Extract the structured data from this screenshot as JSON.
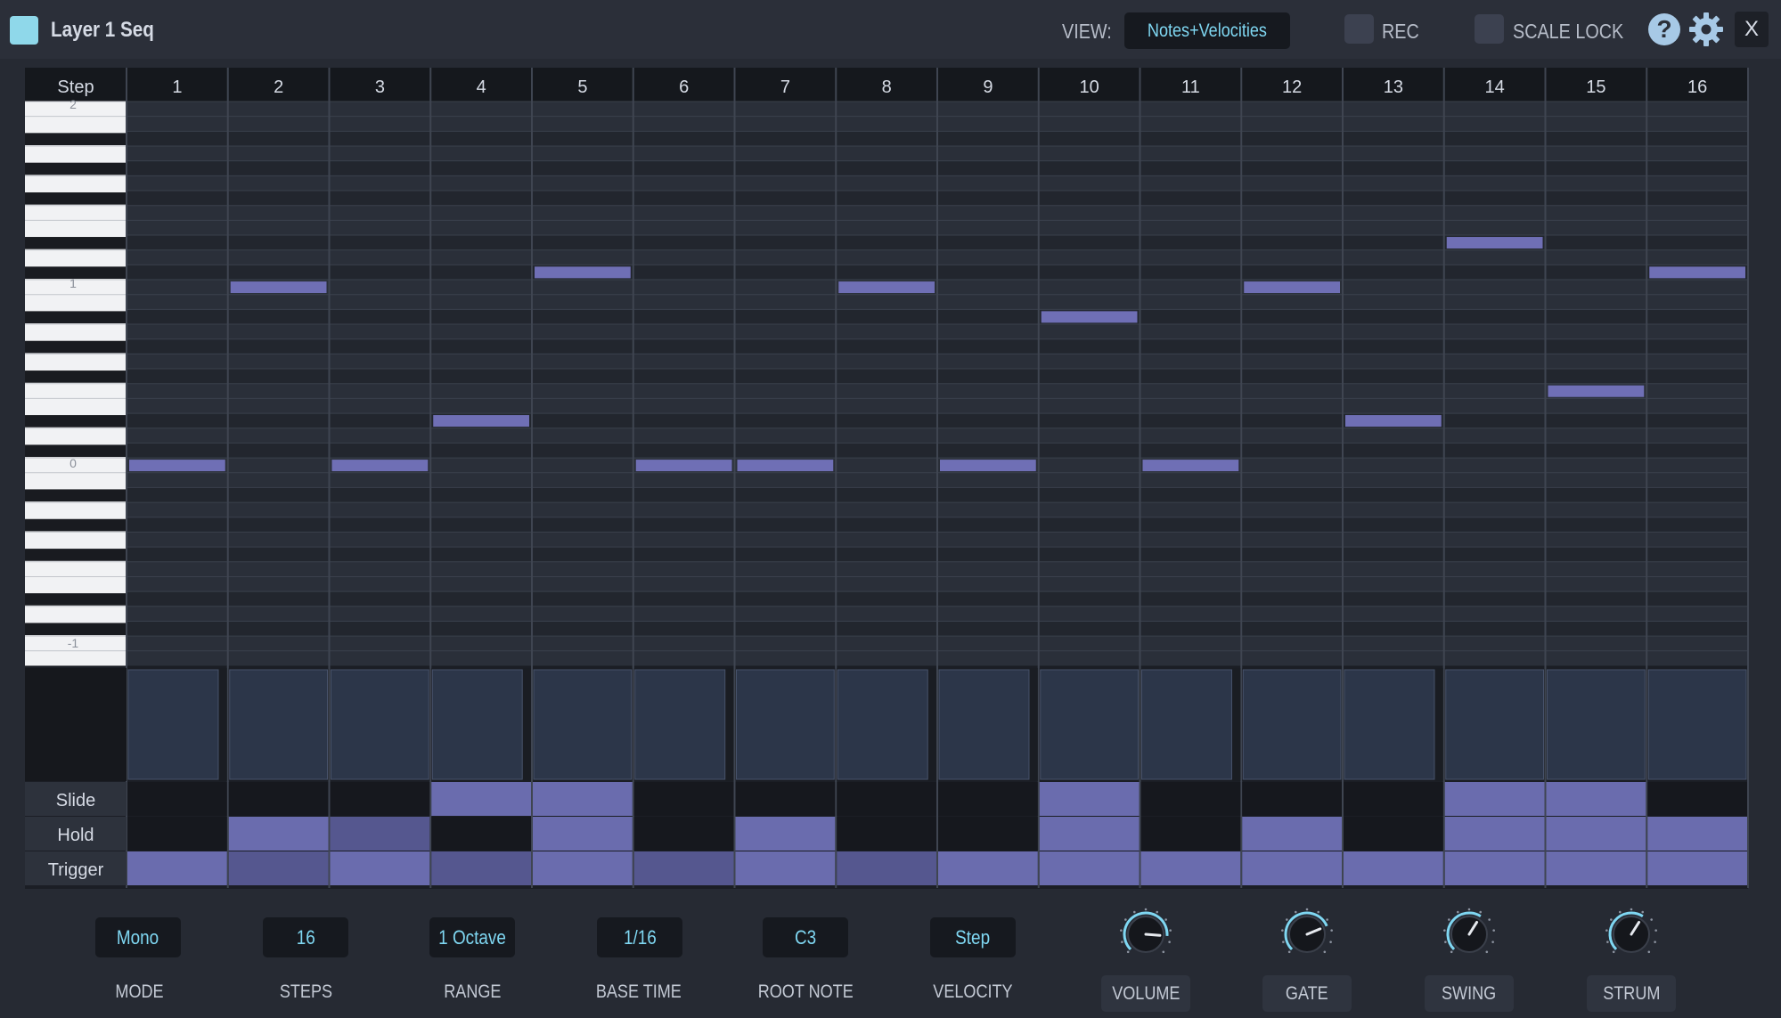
{
  "window": {
    "title": "Layer 1 Seq",
    "view_label": "VIEW:",
    "view_value": "Notes+Velocities",
    "rec_label": "REC",
    "scale_lock_label": "SCALE LOCK",
    "help_glyph": "?",
    "close_label": "X"
  },
  "sequencer": {
    "step_header": "Step",
    "steps": [
      "1",
      "2",
      "3",
      "4",
      "5",
      "6",
      "7",
      "8",
      "9",
      "10",
      "11",
      "12",
      "13",
      "14",
      "15",
      "16"
    ],
    "octave_labels": [
      "2",
      "1",
      "0",
      "-1"
    ],
    "notes_semitones": [
      0,
      12,
      0,
      3,
      13,
      0,
      0,
      12,
      0,
      10,
      0,
      12,
      3,
      15,
      5,
      13
    ],
    "velocities": [
      0.92,
      1.0,
      1.0,
      0.92,
      1.0,
      0.92,
      1.0,
      0.92,
      0.92,
      1.0,
      0.92,
      1.0,
      0.92,
      1.0,
      1.0,
      1.0
    ],
    "row_labels": {
      "slide": "Slide",
      "hold": "Hold",
      "trigger": "Trigger"
    },
    "slide": [
      0,
      0,
      0,
      1,
      1,
      0,
      0,
      0,
      0,
      1,
      0,
      0,
      0,
      1,
      1,
      0
    ],
    "hold": [
      0,
      1,
      2,
      0,
      1,
      0,
      1,
      0,
      0,
      1,
      0,
      1,
      0,
      1,
      1,
      1
    ],
    "trigger": [
      1,
      2,
      1,
      2,
      1,
      2,
      1,
      2,
      1,
      1,
      1,
      1,
      1,
      1,
      1,
      1
    ]
  },
  "controls": {
    "mode": {
      "label": "MODE",
      "value": "Mono"
    },
    "steps": {
      "label": "STEPS",
      "value": "16"
    },
    "range": {
      "label": "RANGE",
      "value": "1 Octave"
    },
    "base_time": {
      "label": "BASE TIME",
      "value": "1/16"
    },
    "root_note": {
      "label": "ROOT NOTE",
      "value": "C3"
    },
    "velocity": {
      "label": "VELOCITY",
      "value": "Step"
    }
  },
  "knobs": {
    "volume": {
      "label": "VOLUME",
      "value": 0.85
    },
    "gate": {
      "label": "GATE",
      "value": 0.75
    },
    "swing": {
      "label": "SWING",
      "value": 0.62
    },
    "strum": {
      "label": "STRUM",
      "value": 0.62
    }
  },
  "colors": {
    "note": "#6f6fb5",
    "active": "#6a6cae",
    "active_dim": "#55578f",
    "velocity_bar": "#2c3649",
    "accent_text": "#7fd7f2"
  }
}
